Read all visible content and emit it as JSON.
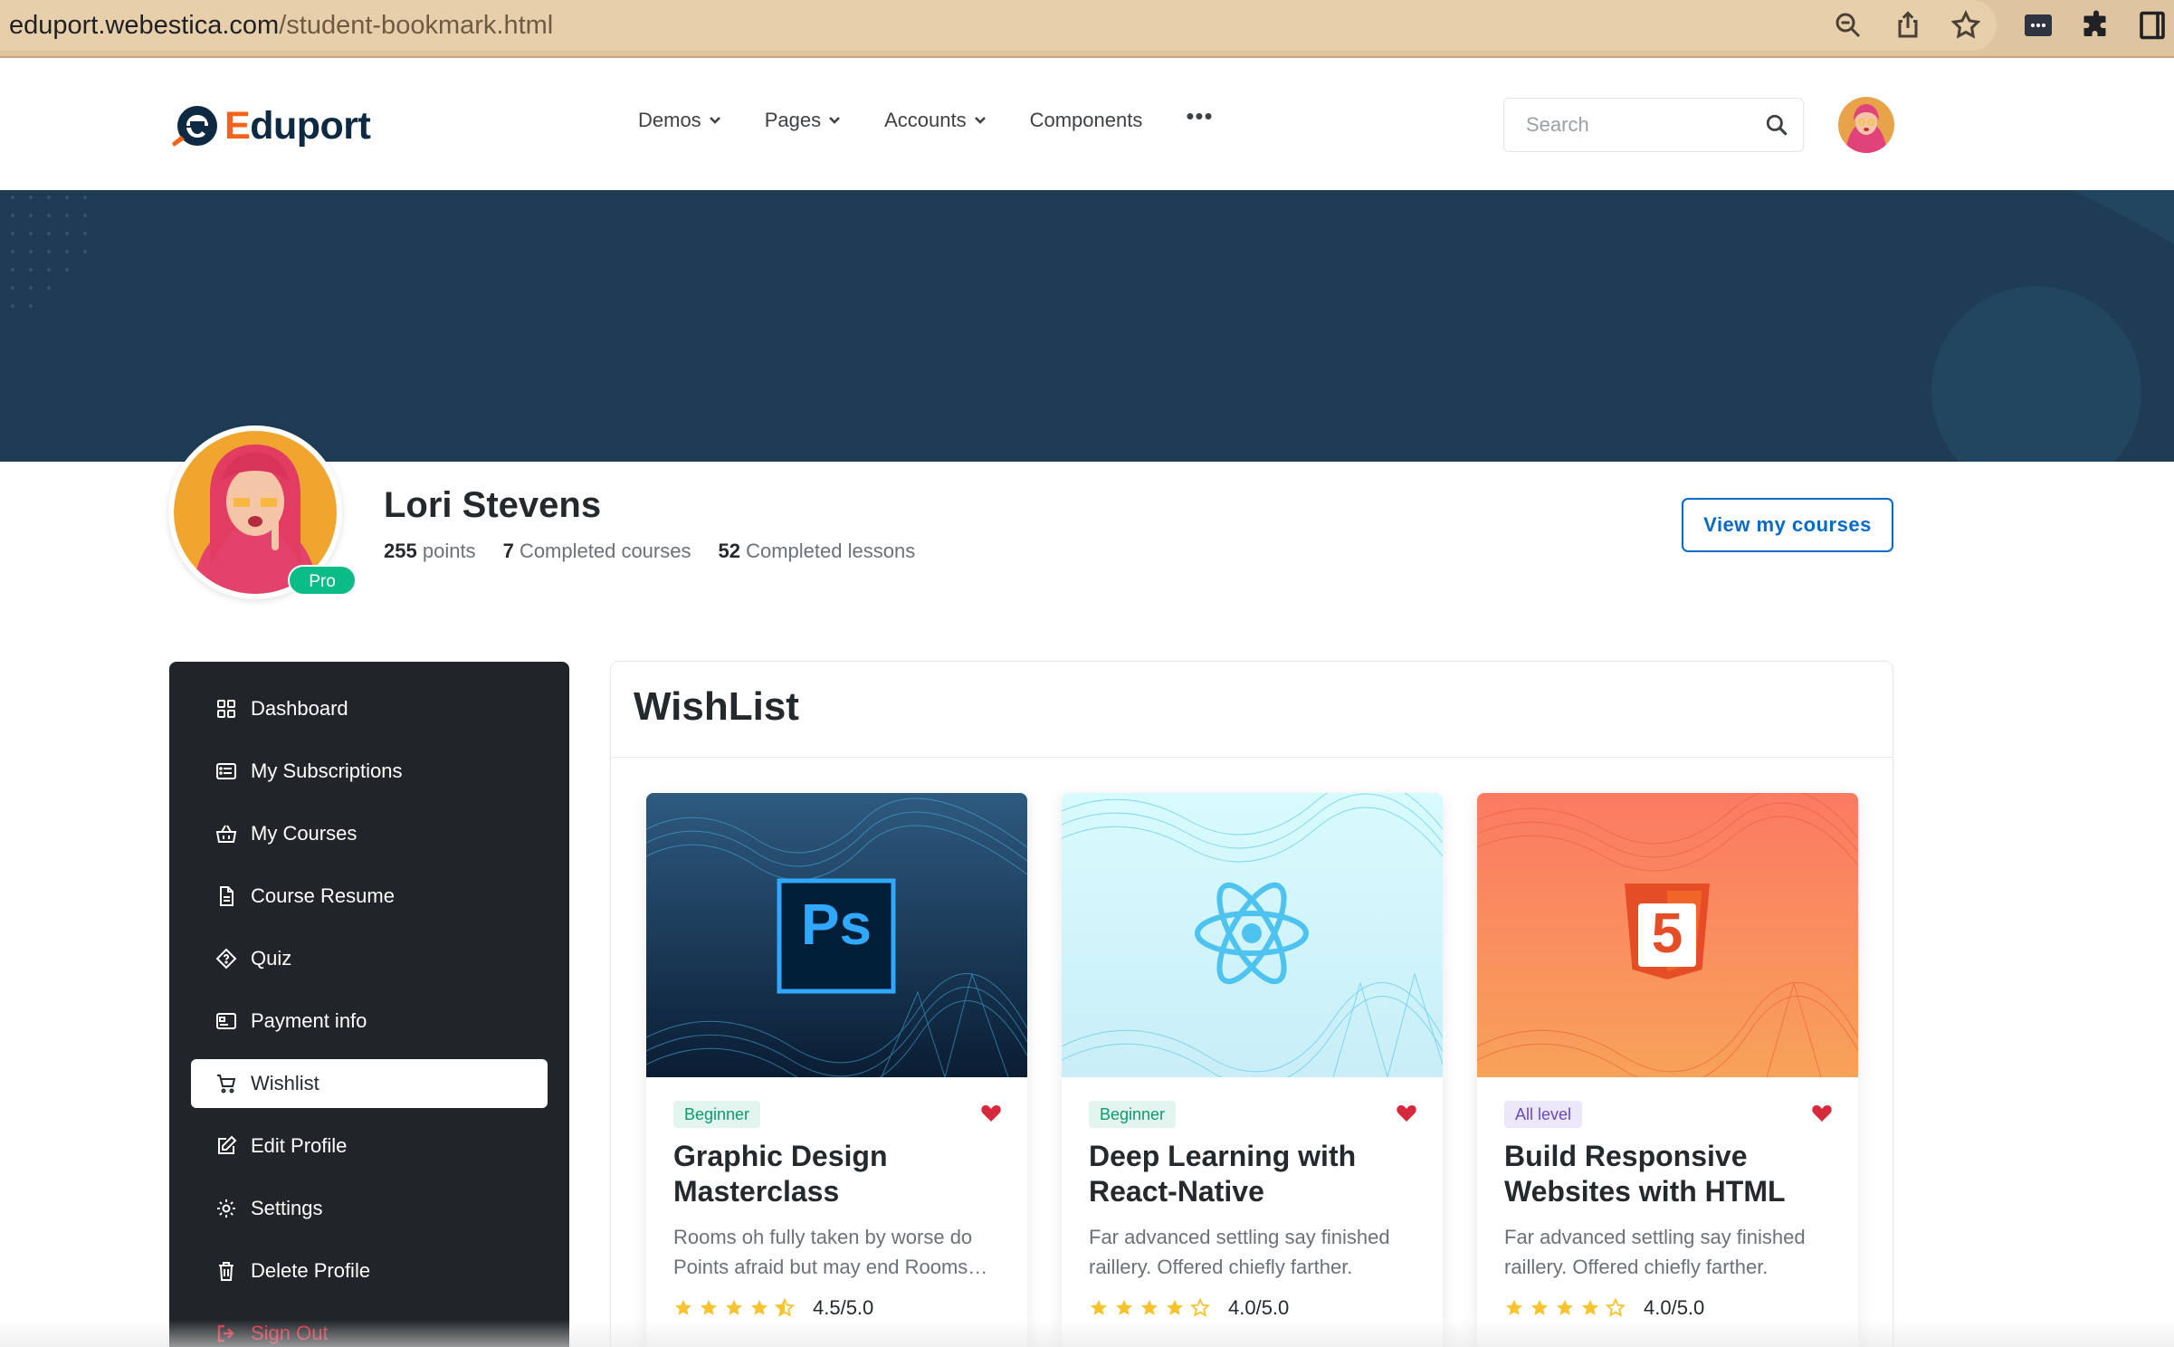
{
  "browser": {
    "url_host": "eduport.webestica.com",
    "url_path": "/student-bookmark.html"
  },
  "header": {
    "logo_e": "E",
    "logo_rest": "duport",
    "nav": [
      {
        "label": "Demos"
      },
      {
        "label": "Pages"
      },
      {
        "label": "Accounts"
      },
      {
        "label": "Components"
      }
    ],
    "more": "•••",
    "search_placeholder": "Search"
  },
  "profile": {
    "name": "Lori Stevens",
    "badge": "Pro",
    "stats": [
      {
        "value": "255",
        "label": "points"
      },
      {
        "value": "7",
        "label": "Completed courses"
      },
      {
        "value": "52",
        "label": "Completed lessons"
      }
    ],
    "view_courses_label": "View my courses"
  },
  "sidebar": {
    "items": [
      {
        "label": "Dashboard",
        "icon": "dashboard-icon"
      },
      {
        "label": "My Subscriptions",
        "icon": "card-list-icon"
      },
      {
        "label": "My Courses",
        "icon": "basket-icon"
      },
      {
        "label": "Course Resume",
        "icon": "file-icon"
      },
      {
        "label": "Quiz",
        "icon": "patch-question-icon"
      },
      {
        "label": "Payment info",
        "icon": "credit-card-icon"
      },
      {
        "label": "Wishlist",
        "icon": "cart-icon",
        "active": true
      },
      {
        "label": "Edit Profile",
        "icon": "pencil-square-icon"
      },
      {
        "label": "Settings",
        "icon": "gear-icon"
      },
      {
        "label": "Delete Profile",
        "icon": "trash-icon"
      },
      {
        "label": "Sign Out",
        "icon": "sign-out-icon"
      }
    ]
  },
  "wishlist": {
    "title": "WishList",
    "courses": [
      {
        "level": "Beginner",
        "title": "Graphic Design Masterclass",
        "description": "Rooms oh fully taken by worse do Points afraid but may end Rooms…",
        "rating": 4.5,
        "rating_text": "4.5/5.0",
        "logo_text": "Ps"
      },
      {
        "level": "Beginner",
        "title": "Deep Learning with React-Native",
        "description": "Far advanced settling say finished raillery. Offered chiefly farther.",
        "rating": 4.0,
        "rating_text": "4.0/5.0"
      },
      {
        "level": "All level",
        "title": "Build Responsive Websites with HTML",
        "description": "Far advanced settling say finished raillery. Offered chiefly farther.",
        "rating": 4.0,
        "rating_text": "4.0/5.0",
        "logo_text": "5"
      }
    ]
  },
  "colors": {
    "primary": "#066ac9",
    "banner": "#1f3c54",
    "sidebar": "#212529",
    "success": "#0cbc87",
    "danger": "#d6293e",
    "star": "#f7c32e",
    "logo_orange": "#f5631a"
  }
}
